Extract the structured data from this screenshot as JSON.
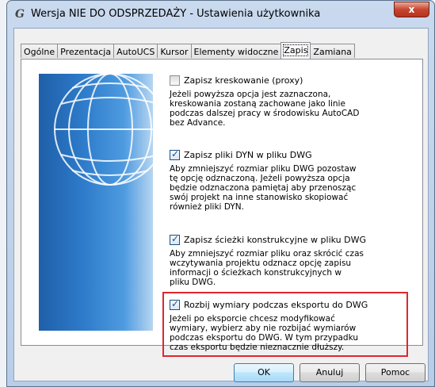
{
  "window": {
    "title": "Wersja NIE DO ODSPRZEDAŻY - Ustawienia użytkownika",
    "close_label": "x"
  },
  "tabs": [
    {
      "label": "Ogólne",
      "active": false
    },
    {
      "label": "Prezentacja",
      "active": false
    },
    {
      "label": "AutoUCS",
      "active": false
    },
    {
      "label": "Kursor",
      "active": false
    },
    {
      "label": "Elementy widoczne",
      "active": false
    },
    {
      "label": "Zapis",
      "active": true
    },
    {
      "label": "Zamiana",
      "active": false
    }
  ],
  "options": [
    {
      "label": "Zapisz kreskowanie (proxy)",
      "checked": false,
      "description": "Jeżeli powyższa opcja jest zaznaczona, kreskowania zostaną zachowane jako linie podczas dalszej pracy w środowisku AutoCAD bez Advance."
    },
    {
      "label": "Zapisz pliki DYN w pliku DWG",
      "checked": true,
      "description": "Aby zmniejszyć rozmiar pliku DWG pozostaw tę opcję odznaczoną. Jeżeli powyższa opcja będzie odznaczona pamiętaj aby przenosząc swój projekt na inne stanowisko skopiować również pliki DYN."
    },
    {
      "label": "Zapisz ścieżki konstrukcyjne w pliku DWG",
      "checked": true,
      "description": "Aby zmniejszyć rozmiar pliku oraz skrócić czas wczytywania projektu odznacz opcję zapisu informacji o ścieżkach konstrukcyjnych w pliku DWG."
    },
    {
      "label": "Rozbij wymiary podczas eksportu do DWG",
      "checked": true,
      "description": "Jeżeli po eksporcie chcesz modyfikować wymiary, wybierz aby nie rozbijać wymiarów podczas eksportu do DWG. W tym przypadku czas eksportu będzie nieznacznie dłuższy."
    }
  ],
  "buttons": {
    "ok": "OK",
    "cancel": "Anuluj",
    "help": "Pomoc"
  },
  "colors": {
    "highlight": "#e0262d",
    "check": "#1c4f8b"
  }
}
